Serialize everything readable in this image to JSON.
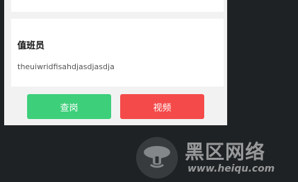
{
  "cards": {
    "duty": {
      "title": "值班员",
      "content": "theuiwridfisahdjasdjasdja"
    }
  },
  "actions": {
    "check_label": "查岗",
    "video_label": "视频"
  },
  "watermark": {
    "title": "黑区网络",
    "url": "www.heiqu.com",
    "logo_icon": "mushroom-icon"
  },
  "colors": {
    "check_button": "#3ecf7b",
    "video_button": "#f44a4a",
    "background": "#1f2224",
    "panel": "#f2f2f2"
  }
}
